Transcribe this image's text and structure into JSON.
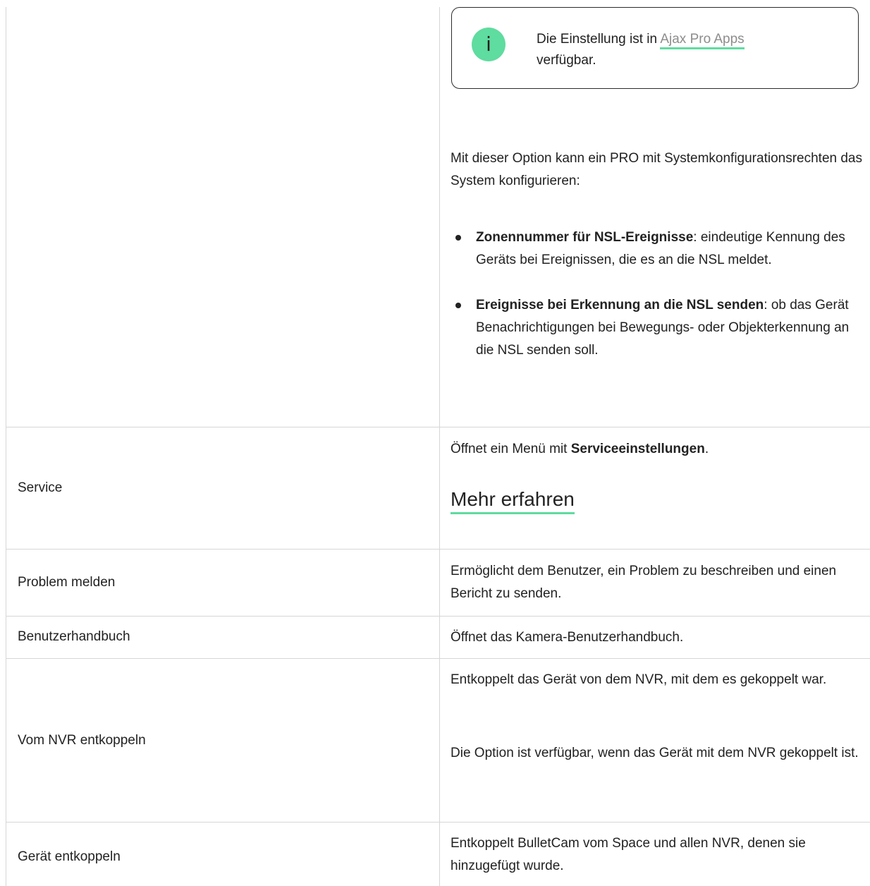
{
  "note": {
    "icon": "info-icon",
    "text_before": "Die Einstellung ist in ",
    "link": "Ajax Pro Apps",
    "text_after": "verfügbar."
  },
  "nsl_option": {
    "intro": "Mit dieser Option kann ein PRO mit Systemkonfigurationsrechten das System konfigurieren:",
    "items": [
      {
        "bold": "Zonennummer für NSL-Ereignisse",
        "text": ": eindeutige Kennung des Geräts bei Ereignissen, die es an die NSL meldet."
      },
      {
        "bold": "Ereignisse bei Erkennung an die NSL senden",
        "text": ": ob das Gerät Benachrichtigungen bei Bewegungs- oder Objekterkennung an die NSL senden soll."
      }
    ]
  },
  "rows": [
    {
      "name": "Service",
      "desc_before": "Öffnet ein Menü mit ",
      "desc_bold": "Serviceeinstellungen",
      "desc_after": ".",
      "link": "Mehr erfahren"
    },
    {
      "name": "Problem melden",
      "desc": "Ermöglicht dem Benutzer, ein Problem zu beschreiben und einen Bericht zu senden."
    },
    {
      "name": "Benutzerhandbuch",
      "desc": "Öffnet das Kamera-Benutzerhandbuch."
    },
    {
      "name": "Vom NVR entkoppeln",
      "desc": "Entkoppelt das Gerät von dem NVR, mit dem es gekoppelt war.",
      "desc2": "Die Option ist verfügbar, wenn das Gerät mit dem NVR gekoppelt ist."
    },
    {
      "name": "Gerät entkoppeln",
      "desc": "Entkoppelt BulletCam vom Space und allen NVR, denen sie hinzugefügt wurde."
    }
  ],
  "colors": {
    "accent": "#5fdc9f",
    "border": "#d6d6d6",
    "text": "#222222",
    "link_muted": "#8d8d8d"
  }
}
